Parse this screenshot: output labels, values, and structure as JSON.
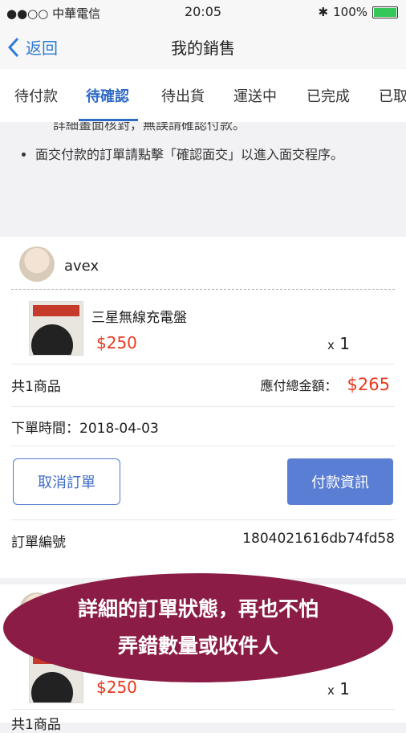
{
  "status_bar": {
    "carrier": "●●○○ 中華電信",
    "time": "20:05",
    "battery": "100%"
  },
  "nav": {
    "back_label": "返回",
    "title": "我的銷售"
  },
  "tabs": [
    {
      "label": "待付款"
    },
    {
      "label": "待確認",
      "active": true
    },
    {
      "label": "待出貨"
    },
    {
      "label": "運送中"
    },
    {
      "label": "已完成"
    },
    {
      "label": "已取"
    }
  ],
  "notice": {
    "cut_line": "詳細畫面核對，無誤請確認付款。",
    "items": [
      "面交付款的訂單請點擊「確認面交」以進入面交程序。"
    ]
  },
  "order1": {
    "user": "avex",
    "product_name": "三星無線充電盤",
    "price": "$250",
    "qty": "1",
    "qty_prefix": "x",
    "total_items": "共1商品",
    "total_label": "應付總金額：",
    "total_amount": "$265",
    "order_date": "下單時間：2018-04-03",
    "cancel_label": "取消訂單",
    "payinfo_label": "付款資訊",
    "order_no_label": "訂單編號",
    "order_no": "1804021616db74fd58"
  },
  "order2": {
    "price": "$250",
    "qty": "1",
    "qty_prefix": "x",
    "total_items": "共1商品"
  },
  "banner": {
    "line1": "詳細的訂單狀態，再也不怕",
    "line2": "弄錯數量或收件人"
  },
  "colors": {
    "accent": "#2f6bc6",
    "price": "#e8391e",
    "banner": "#8b1c45",
    "button": "#5a7ed3"
  }
}
